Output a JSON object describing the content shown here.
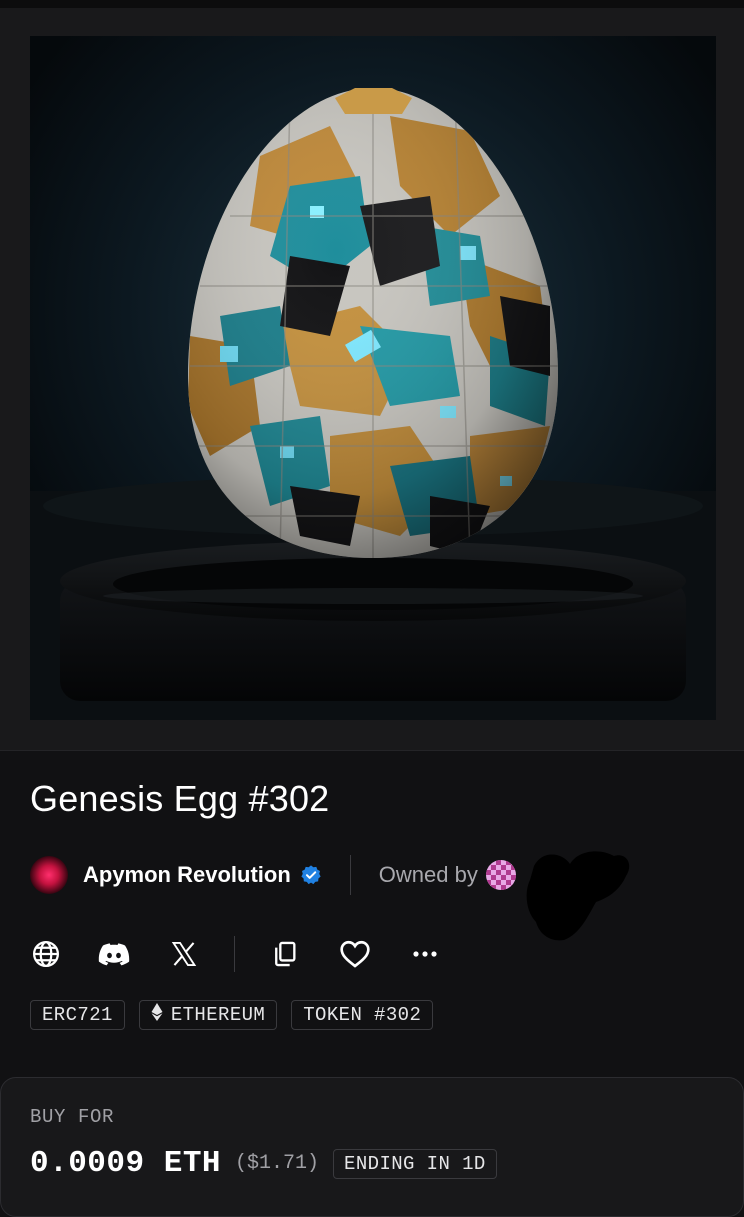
{
  "item": {
    "title": "Genesis Egg #302"
  },
  "collection": {
    "name": "Apymon Revolution",
    "verified": true,
    "avatar_icon": "collection-avatar"
  },
  "owner": {
    "label": "Owned by",
    "avatar_icon": "owner-avatar"
  },
  "actions": [
    {
      "name": "website",
      "icon": "globe-icon"
    },
    {
      "name": "discord",
      "icon": "discord-icon"
    },
    {
      "name": "x",
      "icon": "x-logo-icon"
    },
    {
      "name": "copy",
      "icon": "copy-icon"
    },
    {
      "name": "favorite",
      "icon": "heart-icon"
    },
    {
      "name": "more",
      "icon": "more-icon"
    }
  ],
  "tags": {
    "standard": "ERC721",
    "chain": "ETHEREUM",
    "token": "TOKEN #302"
  },
  "listing": {
    "label": "BUY FOR",
    "price": "0.0009 ETH",
    "price_usd": "($1.71)",
    "ending": "ENDING IN 1D"
  },
  "colors": {
    "background": "#111113",
    "card": "#19191b",
    "verified": "#2081e2",
    "muted_text": "#a8a8ad"
  }
}
